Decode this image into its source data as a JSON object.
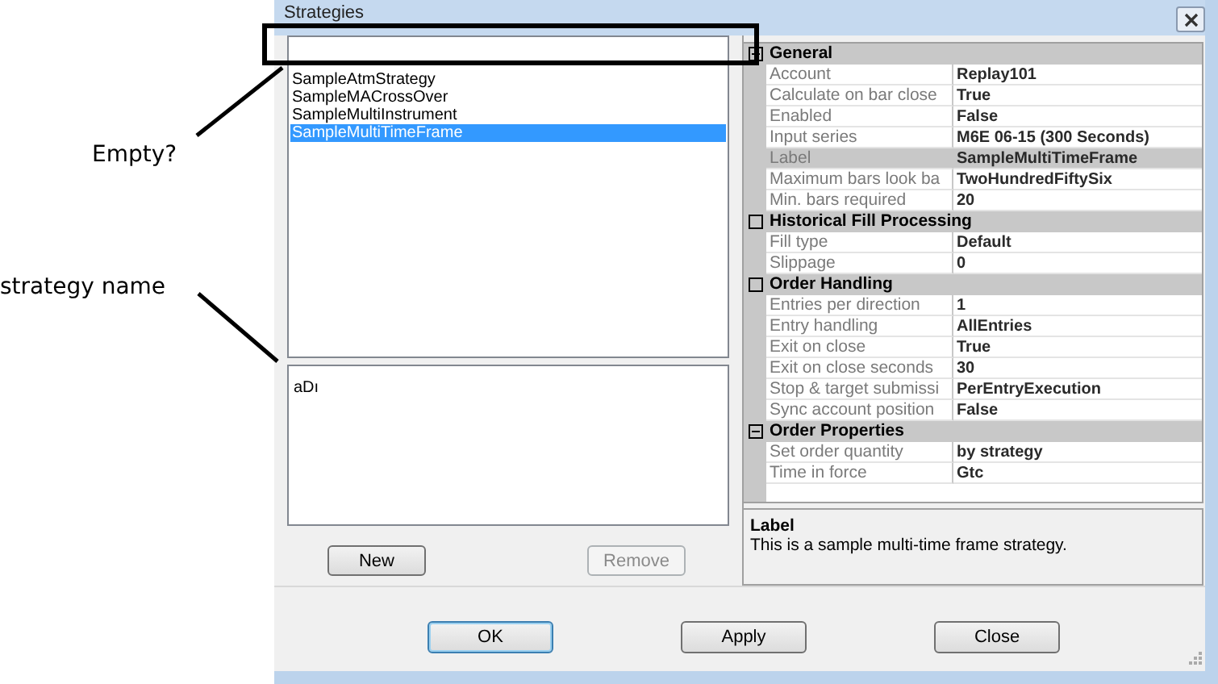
{
  "annotations": [
    {
      "text": "Empty?"
    },
    {
      "text": "strategy name"
    }
  ],
  "window": {
    "title": "Strategies"
  },
  "strategies": [
    {
      "name": "SampleAtmStrategy",
      "selected": false
    },
    {
      "name": "SampleMACrossOver",
      "selected": false
    },
    {
      "name": "SampleMultiInstrument",
      "selected": false
    },
    {
      "name": "SampleMultiTimeFrame",
      "selected": true
    }
  ],
  "description_field": {
    "value": "aDı"
  },
  "list_buttons": [
    {
      "label": "New",
      "disabled": false
    },
    {
      "label": "Remove",
      "disabled": true
    }
  ],
  "properties": [
    {
      "category": "General",
      "expanded": true,
      "items": [
        {
          "name": "Account",
          "value": "Replay101",
          "selected": false
        },
        {
          "name": "Calculate on bar close",
          "value": "True",
          "selected": false
        },
        {
          "name": "Enabled",
          "value": "False",
          "selected": false
        },
        {
          "name": "Input series",
          "value": "M6E 06-15 (300 Seconds)",
          "selected": false
        },
        {
          "name": "Label",
          "value": "SampleMultiTimeFrame",
          "selected": true
        },
        {
          "name": "Maximum bars look ba",
          "value": "TwoHundredFiftySix",
          "selected": false
        },
        {
          "name": "Min. bars required",
          "value": "20",
          "selected": false
        }
      ]
    },
    {
      "category": "Historical Fill Processing",
      "expanded": false,
      "items": [
        {
          "name": "Fill type",
          "value": "Default",
          "selected": false
        },
        {
          "name": "Slippage",
          "value": "0",
          "selected": false
        }
      ]
    },
    {
      "category": "Order Handling",
      "expanded": false,
      "items": [
        {
          "name": "Entries per direction",
          "value": "1",
          "selected": false
        },
        {
          "name": "Entry handling",
          "value": "AllEntries",
          "selected": false
        },
        {
          "name": "Exit on close",
          "value": "True",
          "selected": false
        },
        {
          "name": "Exit on close seconds",
          "value": "30",
          "selected": false
        },
        {
          "name": "Stop & target submissi",
          "value": "PerEntryExecution",
          "selected": false
        },
        {
          "name": "Sync account position",
          "value": "False",
          "selected": false
        }
      ]
    },
    {
      "category": "Order Properties",
      "expanded": true,
      "items": [
        {
          "name": "Set order quantity",
          "value": "by strategy",
          "selected": false
        },
        {
          "name": "Time in force",
          "value": "Gtc",
          "selected": false
        }
      ]
    }
  ],
  "help": {
    "title": "Label",
    "text": "This is a sample multi-time frame strategy."
  },
  "dialog_buttons": [
    {
      "label": "OK",
      "default": true
    },
    {
      "label": "Apply",
      "default": false
    },
    {
      "label": "Close",
      "default": false
    }
  ]
}
